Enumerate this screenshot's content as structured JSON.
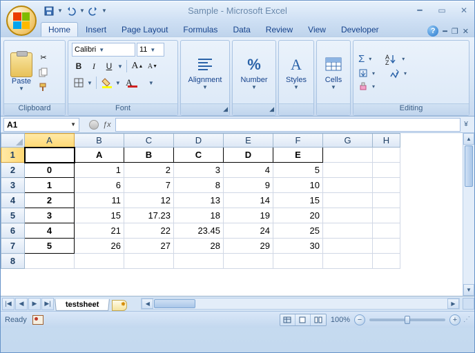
{
  "window": {
    "title": "Sample - Microsoft Excel"
  },
  "qat": {
    "save": "save",
    "undo": "undo",
    "redo": "redo"
  },
  "tabs": [
    "Home",
    "Insert",
    "Page Layout",
    "Formulas",
    "Data",
    "Review",
    "View",
    "Developer"
  ],
  "active_tab": "Home",
  "ribbon": {
    "clipboard": {
      "label": "Clipboard",
      "paste": "Paste"
    },
    "font": {
      "label": "Font",
      "name": "Calibri",
      "size": "11",
      "bold": "B",
      "italic": "I",
      "underline": "U",
      "grow": "A",
      "shrink": "A"
    },
    "alignment": {
      "label": "Alignment"
    },
    "number": {
      "label": "Number"
    },
    "styles": {
      "label": "Styles"
    },
    "cells": {
      "label": "Cells"
    },
    "editing": {
      "label": "Editing",
      "sigma": "Σ"
    }
  },
  "namebox": "A1",
  "fx": "ƒx",
  "columns": [
    "A",
    "B",
    "C",
    "D",
    "E",
    "F",
    "G",
    "H"
  ],
  "rows_hdr": [
    "1",
    "2",
    "3",
    "4",
    "5",
    "6",
    "7",
    "8"
  ],
  "active_cell": "A1",
  "chart_data": {
    "type": "table",
    "columns": [
      "A",
      "B",
      "C",
      "D",
      "E"
    ],
    "index": [
      "0",
      "1",
      "2",
      "3",
      "4",
      "5"
    ],
    "data": [
      [
        1,
        2,
        3,
        4,
        5
      ],
      [
        6,
        7,
        8,
        9,
        10
      ],
      [
        11,
        12,
        13,
        14,
        15
      ],
      [
        15,
        17.23,
        18,
        19,
        20
      ],
      [
        21,
        22,
        23.45,
        24,
        25
      ],
      [
        26,
        27,
        28,
        29,
        30
      ]
    ]
  },
  "sheet": {
    "nav": {
      "first": "|◀",
      "prev": "◀",
      "next": "▶",
      "last": "▶|"
    },
    "tabs": [
      "testsheet"
    ]
  },
  "status": {
    "ready": "Ready",
    "zoom": "100%"
  }
}
